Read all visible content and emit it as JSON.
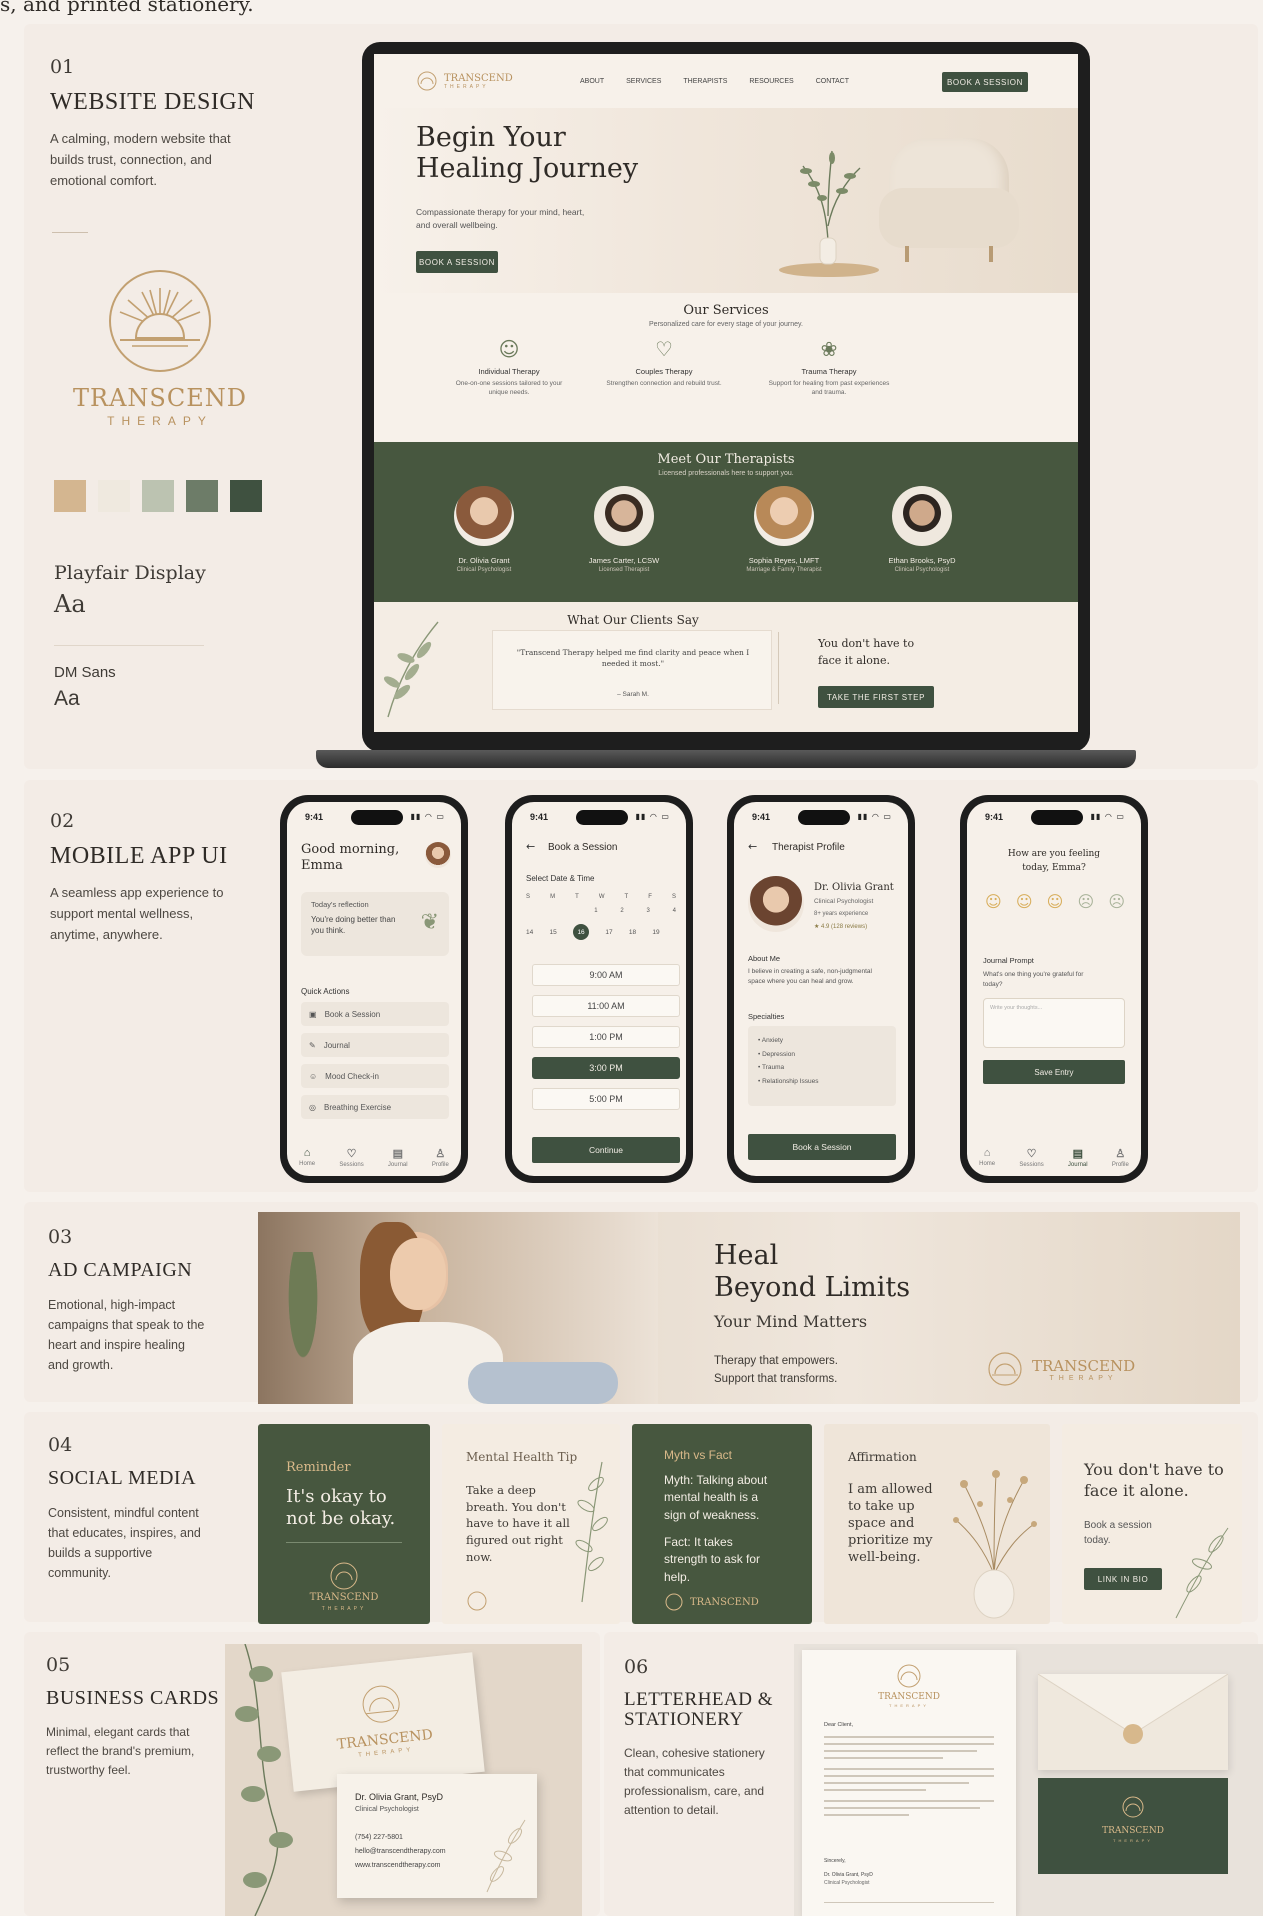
{
  "intro_text": "s, and printed stationery.",
  "sections": {
    "s1": {
      "num": "01",
      "title": "WEBSITE DESIGN",
      "desc": "A calming, modern website that builds trust, connection, and emotional comfort."
    },
    "s2": {
      "num": "02",
      "title": "MOBILE APP UI",
      "desc": "A seamless app experience to support mental wellness, anytime, anywhere."
    },
    "s3": {
      "num": "03",
      "title": "AD CAMPAIGN",
      "desc": "Emotional, high-impact campaigns that speak to the heart and inspire healing and growth."
    },
    "s4": {
      "num": "04",
      "title": "SOCIAL MEDIA",
      "desc": "Consistent, mindful content that educates, inspires, and builds a supportive community."
    },
    "s5": {
      "num": "05",
      "title": "BUSINESS CARDS",
      "desc": "Minimal, elegant cards that reflect the brand's premium, trustworthy feel."
    },
    "s6": {
      "num": "06",
      "title": "LETTERHEAD & STATIONERY",
      "desc": "Clean, cohesive stationery that communicates professionalism, care, and attention to detail."
    }
  },
  "brand": {
    "name": "TRANSCEND",
    "sub": "THERAPY",
    "palette": [
      "#d4b690",
      "#efe9df",
      "#bcc3b1",
      "#6d7c68",
      "#3f5140"
    ],
    "font1_name": "Playfair Display",
    "font1_sample": "Aa",
    "font2_name": "DM Sans",
    "font2_sample": "Aa"
  },
  "website": {
    "nav": [
      "ABOUT",
      "SERVICES",
      "THERAPISTS",
      "RESOURCES",
      "CONTACT"
    ],
    "nav_cta": "BOOK A SESSION",
    "hero_title_1": "Begin Your",
    "hero_title_2": "Healing Journey",
    "hero_text": "Compassionate therapy for your mind, heart, and overall wellbeing.",
    "hero_cta": "BOOK A SESSION",
    "services_title": "Our Services",
    "services_sub": "Personalized care for every stage of your journey.",
    "services": [
      {
        "name": "Individual Therapy",
        "desc": "One-on-one sessions tailored to your unique needs."
      },
      {
        "name": "Couples Therapy",
        "desc": "Strengthen connection and rebuild trust."
      },
      {
        "name": "Trauma Therapy",
        "desc": "Support for healing from past experiences and trauma."
      }
    ],
    "team_title": "Meet Our Therapists",
    "team_sub": "Licensed professionals here to support you.",
    "team": [
      {
        "name": "Dr. Olivia Grant",
        "role": "Clinical Psychologist"
      },
      {
        "name": "James Carter, LCSW",
        "role": "Licensed Therapist"
      },
      {
        "name": "Sophia Reyes, LMFT",
        "role": "Marriage & Family Therapist"
      },
      {
        "name": "Ethan Brooks, PsyD",
        "role": "Clinical Psychologist"
      }
    ],
    "testimonial_title": "What Our Clients Say",
    "testimonial_quote": "\"Transcend Therapy helped me find clarity and peace when I needed it most.\"",
    "testimonial_author": "– Sarah M.",
    "closing_1": "You don't have to",
    "closing_2": "face it alone.",
    "closing_cta": "TAKE THE FIRST STEP"
  },
  "app": {
    "time": "9:41",
    "p1": {
      "greeting_1": "Good morning,",
      "greeting_2": "Emma",
      "reflection_label": "Today's reflection",
      "reflection_text": "You're doing better than you think.",
      "qa_title": "Quick Actions",
      "actions": [
        "Book a Session",
        "Journal",
        "Mood Check-in",
        "Breathing Exercise"
      ],
      "nav": [
        "Home",
        "Sessions",
        "Journal",
        "Profile"
      ]
    },
    "p2": {
      "title": "Book a Session",
      "label": "Select Date & Time",
      "days": [
        "S",
        "M",
        "T",
        "W",
        "T",
        "F",
        "S"
      ],
      "week1": [
        "",
        "",
        "",
        "1",
        "2",
        "3",
        "4"
      ],
      "week2": [
        "14",
        "15",
        "16",
        "17",
        "18",
        "19",
        ""
      ],
      "slots": [
        "9:00 AM",
        "11:00 AM",
        "1:00 PM",
        "3:00 PM",
        "5:00 PM"
      ],
      "selected_slot": "3:00 PM",
      "continue": "Continue"
    },
    "p3": {
      "title": "Therapist Profile",
      "name": "Dr. Olivia Grant",
      "role": "Clinical Psychologist",
      "exp": "8+ years experience",
      "rating": "★ 4.9 (128 reviews)",
      "about_label": "About Me",
      "about": "I believe in creating a safe, non-judgmental space where you can heal and grow.",
      "spec_label": "Specialties",
      "specialties": [
        "Anxiety",
        "Depression",
        "Trauma",
        "Relationship Issues"
      ],
      "cta": "Book a Session"
    },
    "p4": {
      "q1": "How are you feeling",
      "q2": "today, Emma?",
      "prompt_label": "Journal Prompt",
      "prompt": "What's one thing you're grateful for today?",
      "placeholder": "Write your thoughts...",
      "save": "Save Entry",
      "nav": [
        "Home",
        "Sessions",
        "Journal",
        "Profile"
      ]
    }
  },
  "ad": {
    "title_1": "Heal",
    "title_2": "Beyond Limits",
    "tagline": "Your Mind Matters",
    "copy_1": "Therapy that empowers.",
    "copy_2": "Support that transforms."
  },
  "social": {
    "p1_label": "Reminder",
    "p1_text": "It's okay to not be okay.",
    "p2_label": "Mental Health Tip",
    "p2_text": "Take a deep breath. You don't have to have it all figured out right now.",
    "p3_label": "Myth vs Fact",
    "p3_myth": "Myth: Talking about mental health is a sign of weakness.",
    "p3_fact": "Fact: It takes strength to ask for help.",
    "p4_label": "Affirmation",
    "p4_text": "I am allowed to take up space and prioritize my well-being.",
    "p5_title": "You don't have to face it alone.",
    "p5_sub": "Book a session today.",
    "p5_cta": "LINK IN BIO"
  },
  "business_card": {
    "name": "Dr. Olivia Grant, PsyD",
    "role": "Clinical Psychologist",
    "phone": "(754) 227-5801",
    "email": "hello@transcendtherapy.com",
    "web": "www.transcendtherapy.com"
  },
  "letterhead": {
    "salutation": "Dear Client,",
    "signoff": "Sincerely,",
    "signer": "Dr. Olivia Grant, PsyD",
    "signer_role": "Clinical Psychologist"
  }
}
